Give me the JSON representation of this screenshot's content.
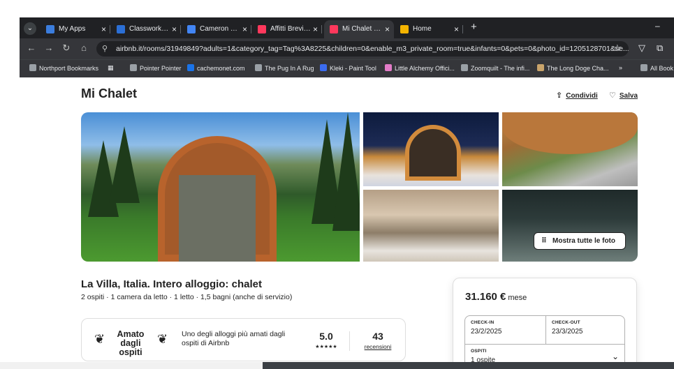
{
  "browser": {
    "tabs": [
      {
        "title": "My Apps",
        "color": "#3b7ddd",
        "active": false
      },
      {
        "title": "Classwork for",
        "color": "#2b6fd6",
        "active": false
      },
      {
        "title": "Cameron Wa",
        "color": "#4285f4",
        "active": false
      },
      {
        "title": "Affitti Brevi Ita",
        "color": "#ff385c",
        "active": false
      },
      {
        "title": "Mi Chalet - C",
        "color": "#ff385c",
        "active": true
      },
      {
        "title": "Home",
        "color": "#f4b400",
        "active": false
      }
    ],
    "url": "airbnb.it/rooms/31949849?adults=1&category_tag=Tag%3A8225&children=0&enable_m3_private_room=true&infants=0&pets=0&photo_id=1205128701&se...",
    "bookmarks": [
      {
        "label": "Northport Bookmarks",
        "color": "#9aa0a6"
      },
      {
        "label": "Pointer Pointer",
        "color": "#9aa0a6"
      },
      {
        "label": "cachemonet.com",
        "color": "#1a73e8"
      },
      {
        "label": "The Pug In A Rug",
        "color": "#9aa0a6"
      },
      {
        "label": "Kleki - Paint Tool",
        "color": "#3b6cf0"
      },
      {
        "label": "Little Alchemy Offici...",
        "color": "#e37cc8"
      },
      {
        "label": "Zoomquilt - The infi...",
        "color": "#9aa0a6"
      },
      {
        "label": "The Long Doge Cha...",
        "color": "#c9a46b"
      },
      {
        "label": "All Book",
        "color": "#9aa0a6"
      }
    ],
    "overflow": "»"
  },
  "listing": {
    "title": "Mi Chalet",
    "share_label": "Condividi",
    "save_label": "Salva",
    "show_all_label": "Mostra tutte le foto",
    "headline": "La Villa, Italia. Intero alloggio: chalet",
    "summary": "2 ospiti · 1 camera da letto · 1 letto · 1,5 bagni (anche di servizio)",
    "guest_fav": {
      "badge": "Amato dagli ospiti",
      "description": "Uno degli alloggi più amati dagli ospiti di Airbnb",
      "rating": "5.0",
      "stars": "★★★★★",
      "reviews": "43",
      "reviews_label": "recensioni"
    }
  },
  "booking": {
    "price": "31.160 €",
    "period": "mese",
    "checkin_label": "CHECK-IN",
    "checkin_value": "23/2/2025",
    "checkout_label": "CHECK-OUT",
    "checkout_value": "23/3/2025",
    "guests_label": "OSPITI",
    "guests_value": "1 ospite"
  }
}
